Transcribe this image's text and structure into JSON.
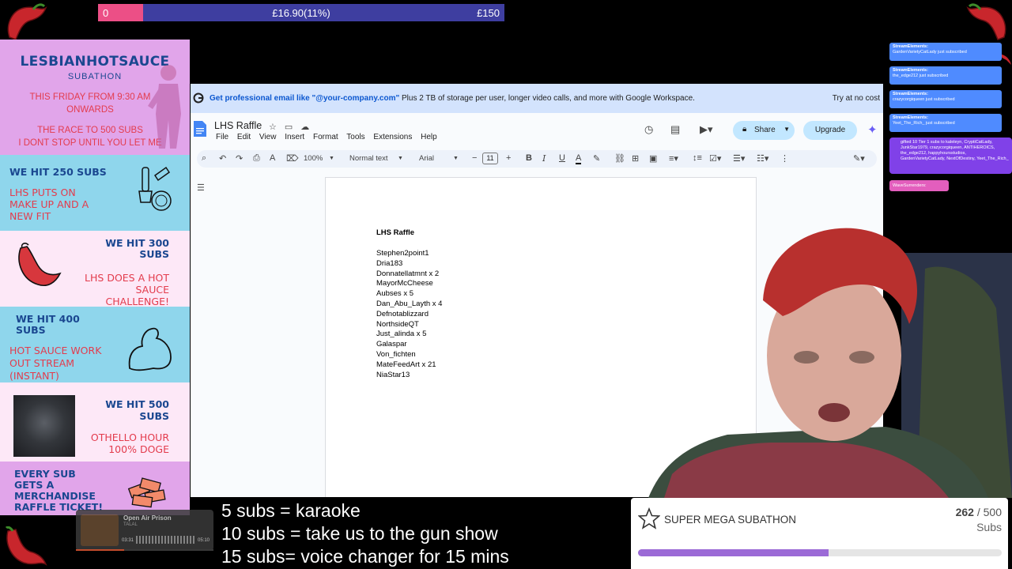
{
  "donation_bar": {
    "start": "0",
    "current": "£16.90(11%)",
    "goal": "£150",
    "progress_fraction": 0.11
  },
  "left_panel": {
    "header": {
      "logo": "LESBIANHOTSAUCE",
      "subtitle": "SUBATHON",
      "line1": "THIS FRIDAY FROM 9:30 AM",
      "line2": "ONWARDS",
      "line3": "THE RACE TO 500 SUBS",
      "line4": "I DONT STOP UNTIL YOU LET ME"
    },
    "goals": [
      {
        "title_1": "WE HIT 250 SUBS",
        "body": [
          "LHS PUTS ON",
          "MAKE UP AND A",
          "NEW FIT"
        ],
        "icon": "makeup-icon"
      },
      {
        "title_1": "WE HIT 300",
        "title_2": "SUBS",
        "body": [
          "LHS DOES A HOT",
          "SAUCE",
          "CHALLENGE!"
        ],
        "icon": "chili-icon"
      },
      {
        "title_1": "WE HIT 400",
        "title_2": "SUBS",
        "body": [
          "HOT SAUCE WORK",
          "OUT STREAM",
          "(INSTANT)"
        ],
        "icon": "flexed-arm-icon"
      },
      {
        "title_1": "WE HIT 500",
        "title_2": "SUBS",
        "body": [
          "OTHELLO HOUR",
          "100% DOGE"
        ],
        "icon": "dog-photo"
      },
      {
        "title_1": "EVERY SUB",
        "title_2": "GETS A",
        "title_3": "MERCHANDISE",
        "title_4": "RAFFLE TICKET!",
        "icon": "tickets-icon"
      }
    ]
  },
  "browser": {
    "promo": {
      "bold": "Get professional email like \"@your-company.com\"",
      "rest": " Plus 2 TB of storage per user, longer video calls, and more with Google Workspace.",
      "cta": "Try at no cost"
    },
    "doc_title": "LHS Raffle",
    "menu": [
      "File",
      "Edit",
      "View",
      "Insert",
      "Format",
      "Tools",
      "Extensions",
      "Help"
    ],
    "share_label": "Share",
    "upgrade_label": "Upgrade",
    "toolbar": {
      "zoom": "100%",
      "style": "Normal text",
      "font": "Arial",
      "size": "11"
    },
    "document": {
      "heading": "LHS Raffle",
      "entries": [
        "Stephen2point1",
        "Dria183",
        "Donnatellatmnt x 2",
        "MayorMcCheese",
        "Aubses x 5",
        "Dan_Abu_Layth x 4",
        "Defnotablizzard",
        "NorthsideQT",
        "Just_alinda x 5",
        "Galaspar",
        "Von_fichten",
        "MateFeedArt x 21",
        "NiaStar13"
      ]
    }
  },
  "chat": {
    "items": [
      {
        "sender": "StreamElements:",
        "text": "GardenVarietyCatLady just subscribed"
      },
      {
        "sender": "StreamElements:",
        "text": "the_edge212 just subscribed"
      },
      {
        "sender": "StreamElements:",
        "text": "crazycorgiqueen just subscribed"
      },
      {
        "sender": "StreamElements:",
        "text": "Yeet_The_Rich_ just subscribed"
      }
    ],
    "gift": "gifted 10 Tier 1 subs to kaleleyn, CryptiCatLady, JunkStar1979, crazycorgiqueen, ANTIHEROICS, the_edge212, happyhoursstudios, GardenVarietyCatLady, NextOfDestiny, Yeet_The_Rich_",
    "raid": "WaveSurrenders:"
  },
  "music_player": {
    "title": "Open Air Prison",
    "artist": "TALAL",
    "elapsed": "03:31",
    "duration": "05:10"
  },
  "sub_goals_text": [
    "5 subs = karaoke",
    "10 subs = take us to the gun show",
    "15 subs= voice changer for 15 mins"
  ],
  "subathon": {
    "title": "SUPER MEGA SUBATHON",
    "current": "262",
    "separator": " / ",
    "target": "500",
    "unit": "Subs",
    "progress_fraction": 0.524
  },
  "colors": {
    "pink": "#ec4f86",
    "navy_bar": "#3e3ea0",
    "lilac": "#e1a5ea",
    "sky": "#8fd6ec",
    "purple_progress": "#9b6ad6"
  }
}
